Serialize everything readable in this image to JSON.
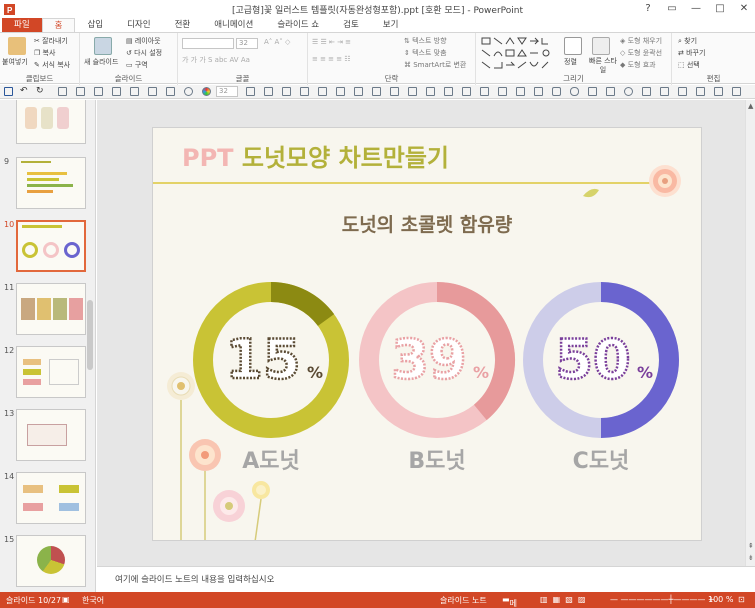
{
  "window": {
    "title": "[고급형]꽃 일러스트 템플릿(자동완성형포함).ppt [호환 모드] - PowerPoint",
    "controls": [
      "?",
      "▭",
      "—",
      "□",
      "✕"
    ]
  },
  "tabs": [
    "파일",
    "홈",
    "삽입",
    "디자인",
    "전환",
    "애니메이션",
    "슬라이드 쇼",
    "검토",
    "보기"
  ],
  "ribbon": {
    "clipboard": {
      "label": "클립보드",
      "paste": "붙여넣기",
      "cut": "잘라내기",
      "copy": "복사",
      "format_painter": "서식 복사"
    },
    "slides": {
      "label": "슬라이드",
      "new_slide": "새 슬라이드",
      "layout": "레이아웃",
      "reset": "다시 설정",
      "section": "구역"
    },
    "font": {
      "label": "글꼴",
      "size": "32"
    },
    "paragraph": {
      "label": "단락",
      "text_direction": "텍스트 방향",
      "align_text": "텍스트 맞춤",
      "smartart": "SmartArt로 변환"
    },
    "drawing": {
      "label": "그리기",
      "arrange": "정렬",
      "quick_styles": "빠른 스타일",
      "shape_fill": "도형 채우기",
      "shape_outline": "도형 윤곽선",
      "shape_effects": "도형 효과"
    },
    "editing": {
      "label": "편집",
      "find": "찾기",
      "replace": "바꾸기",
      "select": "선택"
    }
  },
  "qarow": {
    "font_size": "32"
  },
  "thumbnails": [
    {
      "num": "",
      "selected": false
    },
    {
      "num": "9",
      "selected": false
    },
    {
      "num": "10",
      "selected": true
    },
    {
      "num": "11",
      "selected": false
    },
    {
      "num": "12",
      "selected": false
    },
    {
      "num": "13",
      "selected": false
    },
    {
      "num": "14",
      "selected": false
    },
    {
      "num": "15",
      "selected": false
    }
  ],
  "slide": {
    "title_ppt": "PPT",
    "title_rest": " 도넛모양 차트만들기",
    "subtitle": "도넛의 초콜렛 함유량",
    "chart_data": {
      "type": "pie",
      "series": [
        {
          "name": "A도넛",
          "value": 15,
          "display": "15",
          "unit": "%",
          "light": "#c9c335",
          "dark": "#8c8a12",
          "text": "#5a4a33"
        },
        {
          "name": "B도넛",
          "value": 39,
          "display": "39",
          "unit": "%",
          "light": "#f4c4c6",
          "dark": "#e79a9b",
          "text": "#e9a1a4"
        },
        {
          "name": "C도넛",
          "value": 50,
          "display": "50",
          "unit": "%",
          "light": "#cdcde9",
          "dark": "#6a64cf",
          "text": "#7a3f9b"
        }
      ]
    }
  },
  "notes": {
    "placeholder": "여기에 슬라이드 노트의 내용을 입력하십시오"
  },
  "status": {
    "slide_info": "슬라이드 10/27",
    "language": "한국어",
    "notes": "슬라이드 노트",
    "comments": "메모",
    "zoom": "100 %"
  }
}
